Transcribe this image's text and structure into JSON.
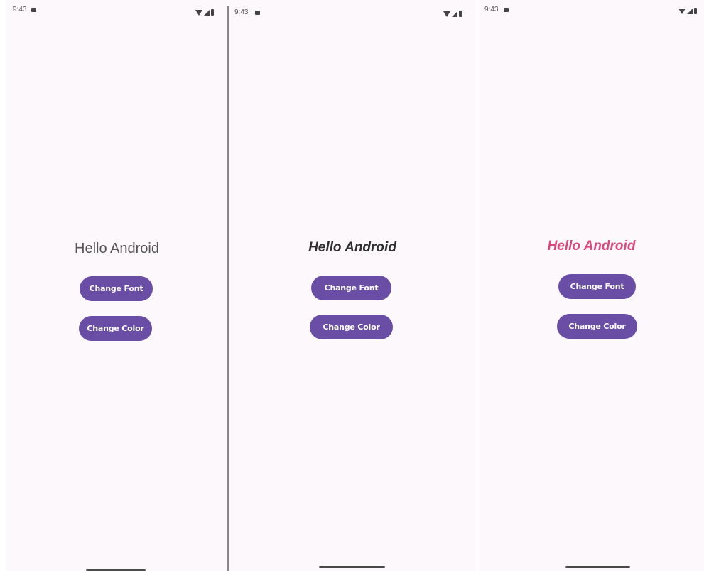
{
  "screens": [
    {
      "status": {
        "time": "9:43"
      },
      "greeting": "Hello Android",
      "buttons": {
        "font_label": "Change Font",
        "color_label": "Change Color"
      }
    },
    {
      "status": {
        "time": "9:43"
      },
      "greeting": "Hello Android",
      "buttons": {
        "font_label": "Change Font",
        "color_label": "Change Color"
      }
    },
    {
      "status": {
        "time": "9:43"
      },
      "greeting": "Hello Android",
      "buttons": {
        "font_label": "Change Font",
        "color_label": "Change Color"
      }
    }
  ],
  "colors": {
    "background": "#fdf8fc",
    "button": "#6a4ea6",
    "button_text": "#ffffff",
    "greeting_default": "#555555",
    "greeting_bold": "#2e2e2e",
    "greeting_pink": "#d94a7a"
  },
  "icons": [
    "notification-icon",
    "wifi-icon",
    "signal-icon",
    "battery-icon"
  ]
}
